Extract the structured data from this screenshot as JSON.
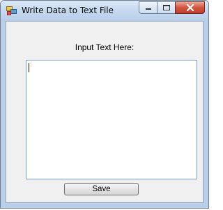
{
  "window": {
    "title": "Write Data to Text File",
    "icon": "app-window-icon",
    "controls": [
      "minimize-icon",
      "maximize-icon",
      "close-icon"
    ]
  },
  "form": {
    "label": "Input Text Here:",
    "text_value": "",
    "save_label": "Save"
  },
  "colors": {
    "title_bar": "#c5d8ef",
    "client_bg": "#f0f0f0",
    "textbox_border": "#7a9cc9",
    "close_button": "#c1392a"
  }
}
